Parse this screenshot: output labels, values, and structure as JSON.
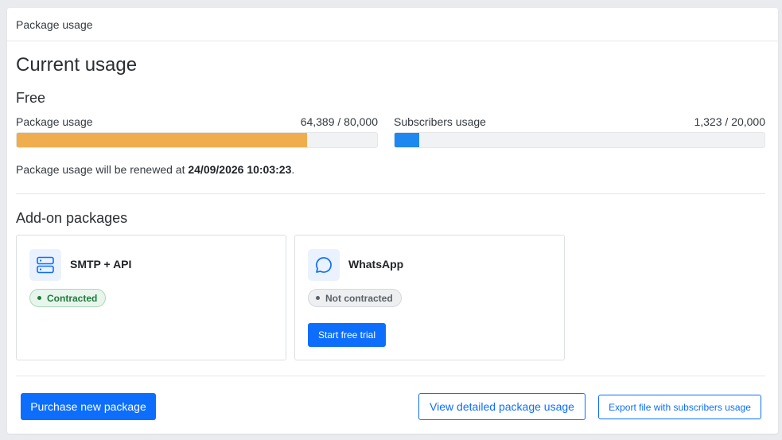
{
  "header": {
    "title": "Package usage"
  },
  "main": {
    "title": "Current usage",
    "plan_name": "Free",
    "package_usage": {
      "label": "Package usage",
      "value_text": "64,389 / 80,000",
      "fraction": 0.805,
      "color": "#f0ad4e"
    },
    "subscribers_usage": {
      "label": "Subscribers usage",
      "value_text": "1,323 / 20,000",
      "fraction": 0.066,
      "color": "#1e88f0"
    },
    "renew": {
      "prefix": "Package usage will be renewed at ",
      "date": "24/09/2026 10:03:23",
      "suffix": "."
    }
  },
  "addons": {
    "title": "Add-on packages",
    "items": [
      {
        "name": "SMTP + API",
        "icon": "server-icon",
        "status": "Contracted"
      },
      {
        "name": "WhatsApp",
        "icon": "chat-bubble-icon",
        "status": "Not contracted",
        "action_label": "Start free trial"
      }
    ]
  },
  "footer": {
    "purchase_label": "Purchase new package",
    "detail_label": "View detailed package usage",
    "export_label": "Export file with subscribers usage"
  },
  "colors": {
    "primary": "#0d6efd",
    "package_bar": "#f0ad4e",
    "subscribers_bar": "#1e88f0",
    "success": "#1f7a3b"
  }
}
